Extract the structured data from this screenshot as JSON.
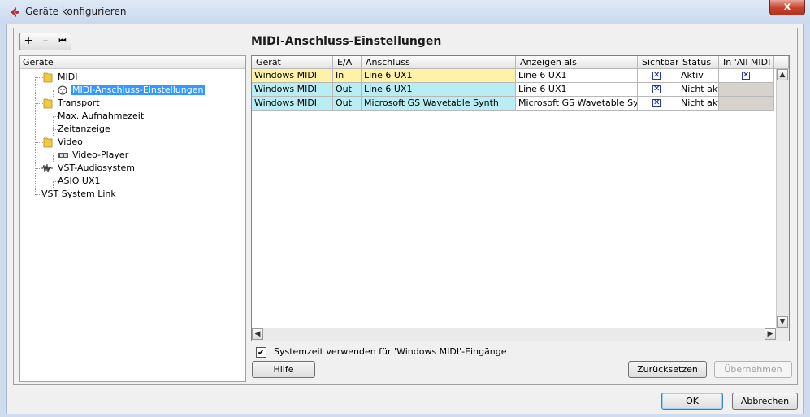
{
  "window": {
    "title": "Geräte konfigurieren",
    "close_label": "x"
  },
  "toolbar": {
    "add_label": "+",
    "remove_label": "–",
    "reset_label": "⏮"
  },
  "tree": {
    "header": "Geräte",
    "items": [
      {
        "label": "MIDI"
      },
      {
        "label": "MIDI-Anschluss-Einstellungen"
      },
      {
        "label": "Transport"
      },
      {
        "label": "Max. Aufnahmezeit"
      },
      {
        "label": "Zeitanzeige"
      },
      {
        "label": "Video"
      },
      {
        "label": "Video-Player"
      },
      {
        "label": "VST-Audiosystem"
      },
      {
        "label": "ASIO UX1"
      },
      {
        "label": "VST System Link"
      }
    ]
  },
  "main": {
    "title": "MIDI-Anschluss-Einstellungen",
    "columns": [
      "Gerät",
      "E/A",
      "Anschluss",
      "Anzeigen als",
      "Sichtbar",
      "Status",
      "In 'All MIDI Inputs'"
    ],
    "rows": [
      {
        "device": "Windows MIDI",
        "io": "In",
        "port": "Line 6 UX1",
        "display": "Line 6 UX1",
        "visible": "✕",
        "status": "Aktiv",
        "all_midi": "✕"
      },
      {
        "device": "Windows MIDI",
        "io": "Out",
        "port": "Line 6 UX1",
        "display": "Line 6 UX1",
        "visible": "✕",
        "status": "Nicht aktiv",
        "all_midi": ""
      },
      {
        "device": "Windows MIDI",
        "io": "Out",
        "port": "Microsoft GS Wavetable Synth",
        "display": "Microsoft GS Wavetable Synth",
        "visible": "✕",
        "status": "Nicht aktiv",
        "all_midi": ""
      }
    ],
    "system_time_checkbox": {
      "label": "Systemzeit verwenden für 'Windows MIDI'-Eingänge",
      "checked": true,
      "mark": "✔"
    }
  },
  "buttons": {
    "help": "Hilfe",
    "reset": "Zurücksetzen",
    "apply": "Übernehmen",
    "ok": "OK",
    "cancel": "Abbrechen"
  },
  "colors": {
    "selected": "#3399ff",
    "row_in": "#fff1a8",
    "row_out": "#b8eef3",
    "inactive_cell": "#d6d3ce"
  }
}
